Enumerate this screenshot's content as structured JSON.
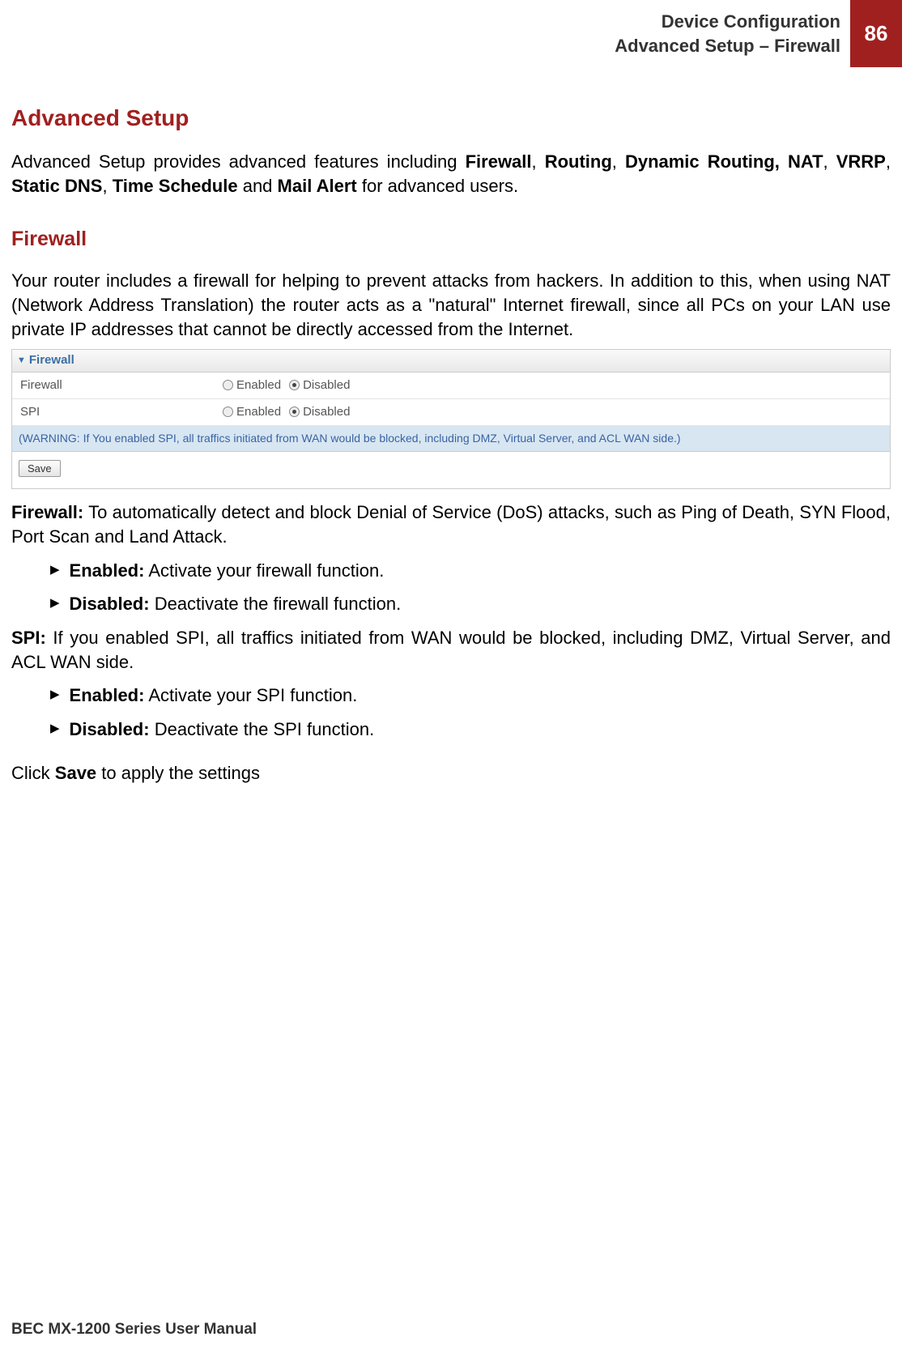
{
  "header": {
    "line1": "Device Configuration",
    "line2": "Advanced Setup – Firewall",
    "page": "86"
  },
  "h1": "Advanced Setup",
  "intro": {
    "pre": "Advanced Setup provides advanced features including ",
    "f1": "Firewall",
    "c1": ", ",
    "f2": "Routing",
    "c2": ", ",
    "f3": "Dynamic Routing, NAT",
    "c3": ", ",
    "f4": "VRRP",
    "c4": ", ",
    "f5": "Static DNS",
    "c5": ", ",
    "f6": "Time Schedule",
    "and": " and ",
    "f7": "Mail Alert",
    "tail": " for advanced users."
  },
  "h2": "Firewall",
  "fwIntro": "Your router includes a firewall for helping to prevent attacks from hackers. In addition to this, when using NAT (Network Address Translation) the router acts as a \"natural\" Internet firewall, since all PCs on your LAN use private IP addresses that cannot be directly accessed from the Internet.",
  "panel": {
    "title": "Firewall",
    "rows": {
      "firewall": {
        "label": "Firewall",
        "enabled": "Enabled",
        "disabled": "Disabled"
      },
      "spi": {
        "label": "SPI",
        "enabled": "Enabled",
        "disabled": "Disabled"
      }
    },
    "warning": "(WARNING: If You enabled SPI, all traffics initiated from WAN would be blocked, including DMZ, Virtual Server, and ACL WAN side.)",
    "save": "Save"
  },
  "firewallDesc": {
    "label": "Firewall:",
    "text": " To automatically detect and block Denial of Service (DoS) attacks, such as Ping of Death, SYN Flood, Port Scan and Land Attack."
  },
  "fwEnabled": {
    "label": "Enabled:",
    "text": " Activate your firewall function."
  },
  "fwDisabled": {
    "label": "Disabled:",
    "text": " Deactivate the firewall function."
  },
  "spiDesc": {
    "label": "SPI:",
    "text": " If you enabled SPI, all traffics initiated from WAN would be blocked, including DMZ, Virtual Server, and ACL WAN side."
  },
  "spiEnabled": {
    "label": "Enabled:",
    "text": " Activate your SPI function."
  },
  "spiDisabled": {
    "label": "Disabled:",
    "text": " Deactivate the SPI function."
  },
  "saveNote": {
    "pre": "Click ",
    "b": "Save",
    "post": " to apply the settings"
  },
  "footer": "BEC MX-1200 Series User Manual"
}
